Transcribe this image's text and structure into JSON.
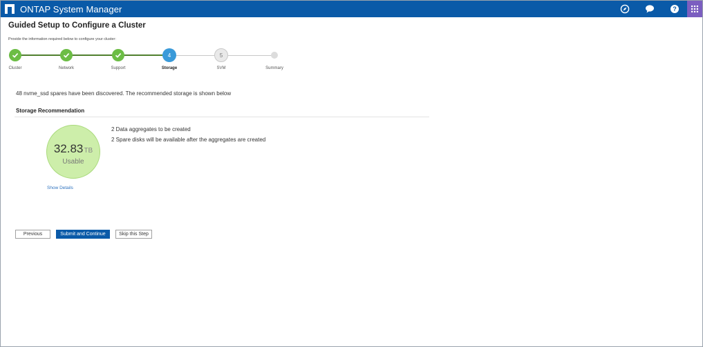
{
  "app": {
    "title": "ONTAP System Manager"
  },
  "header_icons": [
    "compass-icon",
    "chat-icon",
    "help-icon",
    "apps-grid-icon"
  ],
  "page": {
    "title": "Guided Setup to Configure a Cluster",
    "subtitle": "Provide the information required below to configure your cluster:"
  },
  "steps": [
    {
      "label": "Cluster",
      "state": "done"
    },
    {
      "label": "Network",
      "state": "done"
    },
    {
      "label": "Support",
      "state": "done"
    },
    {
      "label": "Storage",
      "state": "current",
      "number": "4"
    },
    {
      "label": "SVM",
      "state": "todo",
      "number": "5"
    },
    {
      "label": "Summary",
      "state": "todo"
    }
  ],
  "storage": {
    "discovered_text": "48 nvme_ssd spares have been discovered. The recommended storage is shown below",
    "section_title": "Storage Recommendation",
    "usable_value": "32.83",
    "usable_unit": "TB",
    "usable_label": "Usable",
    "show_details": "Show Details",
    "lines": [
      "2 Data aggregates to be created",
      "2 Spare disks will be available after the aggregates are created"
    ]
  },
  "buttons": {
    "previous": "Previous",
    "submit": "Submit and Continue",
    "skip": "Skip this Step"
  },
  "colors": {
    "header": "#0a5aa8",
    "apps_button": "#7b5ec0",
    "step_done": "#6cbd45",
    "step_current": "#3a9ad9",
    "usable_fill": "#cdeeaa"
  }
}
